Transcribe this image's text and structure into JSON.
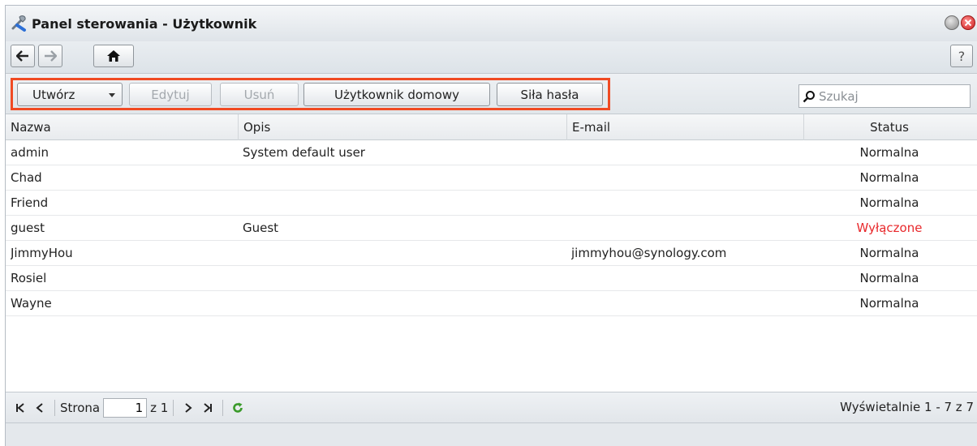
{
  "window": {
    "title": "Panel sterowania - Użytkownik",
    "help_label": "?"
  },
  "toolbar": {
    "create_label": "Utwórz",
    "edit_label": "Edytuj",
    "delete_label": "Usuń",
    "home_user_label": "Użytkownik domowy",
    "password_strength_label": "Siła hasła",
    "search_placeholder": "Szukaj",
    "highlight_color": "#f04a23"
  },
  "table": {
    "columns": [
      "Nazwa",
      "Opis",
      "E-mail",
      "Status"
    ],
    "rows": [
      {
        "name": "admin",
        "description": "System default user",
        "email": "",
        "status": "Normalna"
      },
      {
        "name": "Chad",
        "description": "",
        "email": "",
        "status": "Normalna"
      },
      {
        "name": "Friend",
        "description": "",
        "email": "",
        "status": "Normalna"
      },
      {
        "name": "guest",
        "description": "Guest",
        "email": "",
        "status": "Wyłączone"
      },
      {
        "name": "JimmyHou",
        "description": "",
        "email": "jimmyhou@synology.com",
        "status": "Normalna"
      },
      {
        "name": "Rosiel",
        "description": "",
        "email": "",
        "status": "Normalna"
      },
      {
        "name": "Wayne",
        "description": "",
        "email": "",
        "status": "Normalna"
      }
    ]
  },
  "pager": {
    "page_label": "Strona",
    "page_value": "1",
    "of_label": "z 1",
    "display_info": "Wyświetalnie 1 - 7 z 7"
  },
  "colors": {
    "disabled_status": "#e8282b",
    "refresh_icon": "#3a9a2a"
  }
}
